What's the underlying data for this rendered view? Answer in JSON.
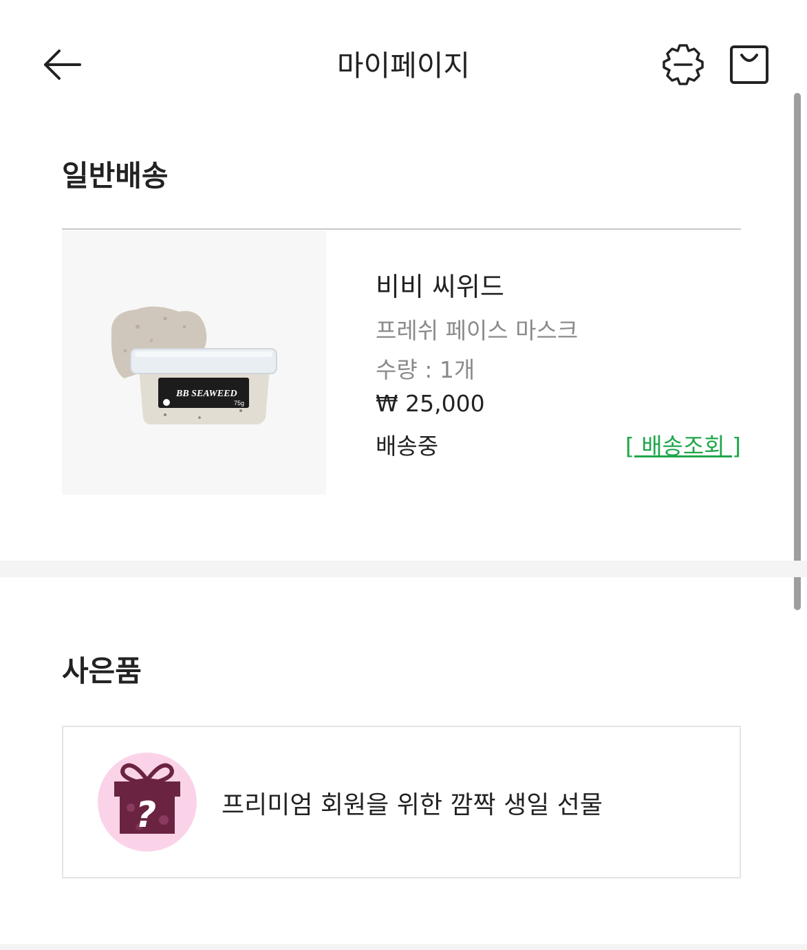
{
  "header": {
    "title": "마이페이지",
    "back_icon": "arrow-left-icon",
    "settings_icon": "gear-icon",
    "cart_icon": "shopping-bag-icon"
  },
  "delivery": {
    "title": "일반배송",
    "product": {
      "name": "비비 씨위드",
      "category": "프레쉬 페이스 마스크",
      "quantity": "수량 : 1개",
      "price": "₩ 25,000",
      "status": "배송중",
      "track_label": "[ 배송조회 ]",
      "image_label": "BB SEAWEED",
      "image_weight": "75g"
    }
  },
  "gift": {
    "title": "사은품",
    "item_text": "프리미엄 회원을 위한 깜짝 생일 선물",
    "icon": "gift-box-question-icon"
  },
  "colors": {
    "accent_green": "#1fa64a",
    "gift_circle": "#fbd3e9",
    "gift_box": "#6a2442"
  }
}
